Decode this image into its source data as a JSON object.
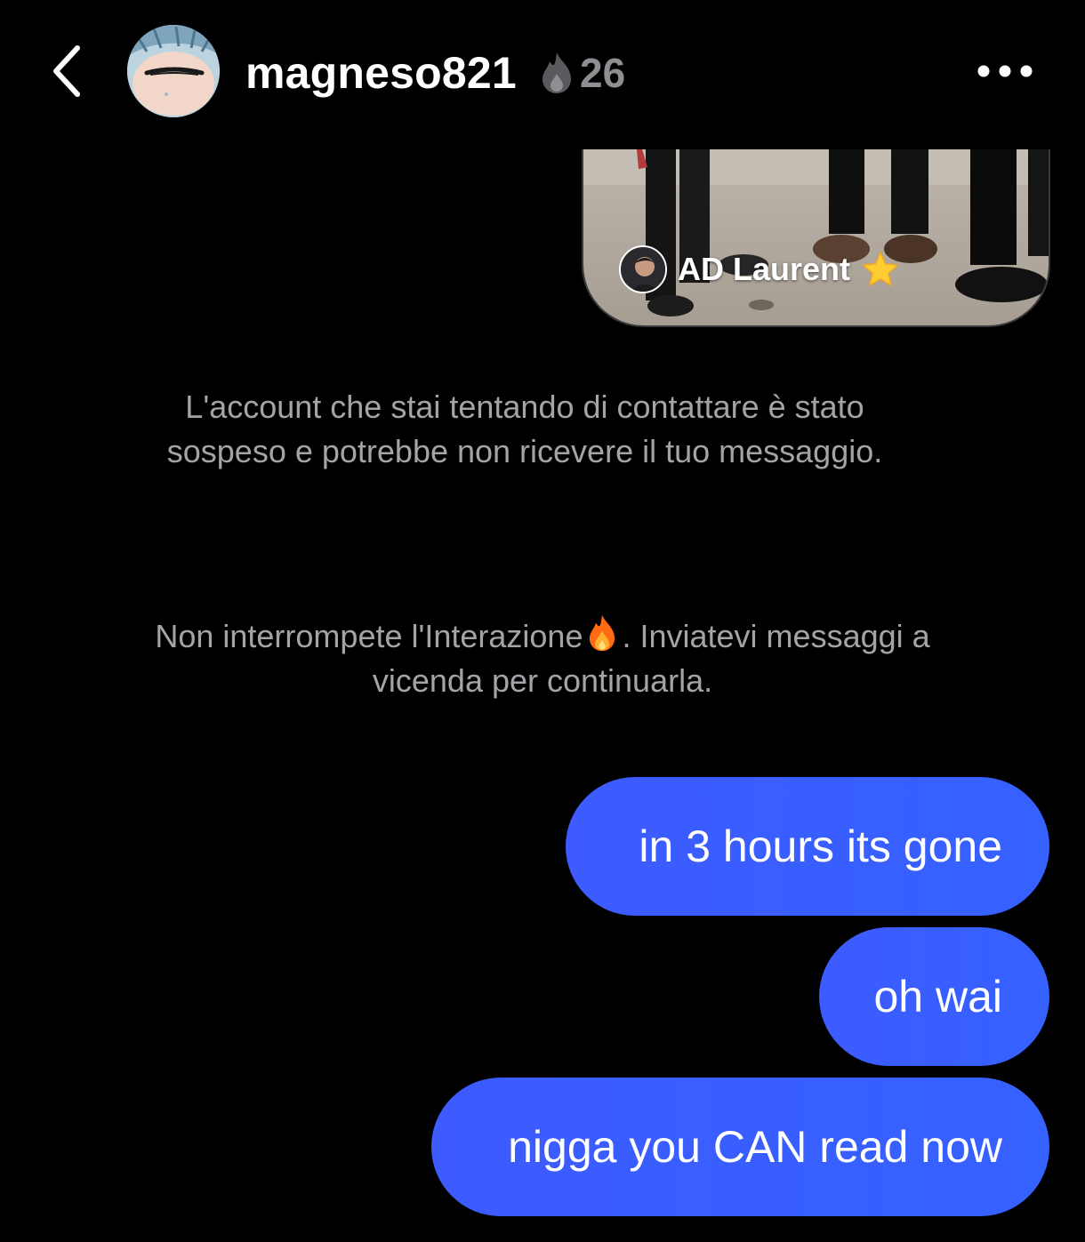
{
  "header": {
    "back_icon": "chevron-left-icon",
    "username": "magneso821",
    "streak_icon": "flame-icon",
    "streak_count": "26",
    "more_icon": "more-horizontal-icon"
  },
  "shared_post": {
    "author_name": "AD Laurent",
    "author_badge_icon": "star-icon"
  },
  "notices": {
    "suspended_text": "L'account che stai tentando di contattare è stato sospeso e potrebbe non ricevere il tuo messaggio.",
    "streak_text_before": "Non interrompete l'Interazione",
    "streak_text_after": ". Inviatevi messaggi a vicenda per continuarla.",
    "streak_icon": "flame-icon"
  },
  "messages": [
    {
      "text": "in 3 hours its gone",
      "sender": "me"
    },
    {
      "text": "oh wai",
      "sender": "me"
    },
    {
      "text": "nigga you CAN read now",
      "sender": "me"
    }
  ],
  "colors": {
    "background": "#000000",
    "bubble": "#3a5cff",
    "notice_text": "#a4a4a8",
    "streak_count": "#8e8e93"
  }
}
